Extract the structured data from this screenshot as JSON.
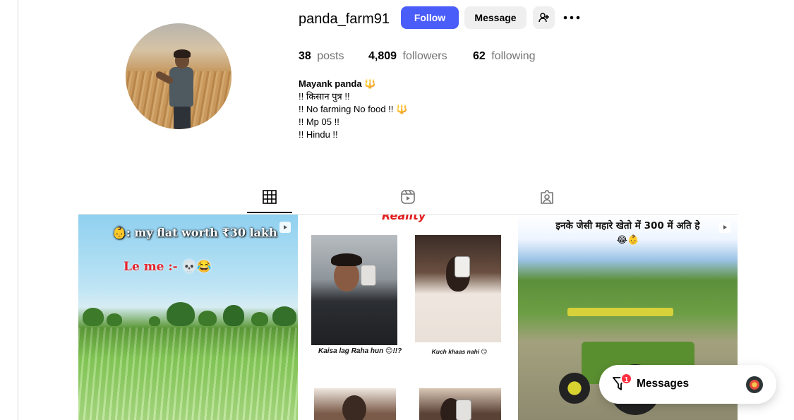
{
  "profile": {
    "username": "panda_farm91",
    "follow_label": "Follow",
    "message_label": "Message",
    "stats": {
      "posts_count": "38",
      "posts_label": "posts",
      "followers_count": "4,809",
      "followers_label": "followers",
      "following_count": "62",
      "following_label": "following"
    },
    "bio": {
      "name": "Mayank panda 🔱",
      "line1": "!! किसान पुत्र !!",
      "line2": "!! No farming No food !! 🔱",
      "line3": "!! Mp 05 !!",
      "line4": "!! Hindu !!"
    }
  },
  "tabs": {
    "posts_icon": "grid-icon",
    "reels_icon": "reels-icon",
    "tagged_icon": "tagged-icon",
    "active": "posts"
  },
  "posts": {
    "tile1": {
      "title": "👶: my flat worth ₹30 lakh",
      "subtitle": "Le me :- 💀😂"
    },
    "tile2": {
      "header": "Reality",
      "caption_left": "Kaisa lag Raha hun 😊!!?",
      "caption_right": "Kuch khaas nahi 😏"
    },
    "tile3": {
      "title": "इनके जेसी महारे खेतो में 300 में अति हे",
      "emoji": "😂👶"
    }
  },
  "messages": {
    "label": "Messages",
    "unread": "1"
  },
  "colors": {
    "follow_button": "#4a5df9",
    "secondary_button": "#efefef",
    "badge": "#ff3040"
  }
}
